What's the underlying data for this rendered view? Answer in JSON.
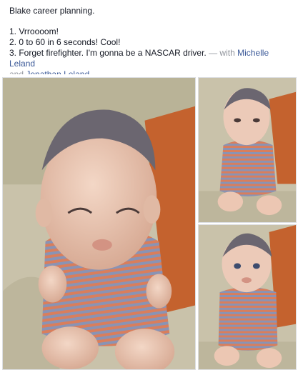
{
  "post": {
    "title": "Blake career planning.",
    "list": [
      "1. Vrroooom!",
      "2. 0 to 60 in 6 seconds! Cool!",
      "3. Forget firefighter. I'm gonna be a NASCAR driver."
    ],
    "with_prefix": " — with ",
    "tagged": [
      "Michelle Leland",
      "Jonathan Leland"
    ],
    "and_word": " and ",
    "end_punct": "."
  },
  "colors": {
    "link": "#3b5998",
    "muted": "#90949c",
    "text": "#141823",
    "couch_beige": "#c7bfa4",
    "pillow_orange": "#c4622e",
    "onesie_stripe_blue": "#8a93b4",
    "onesie_stripe_orange": "#d97e5c"
  },
  "photos": [
    {
      "name": "main photo",
      "icon": "baby-photo"
    },
    {
      "name": "top-right photo",
      "icon": "baby-photo"
    },
    {
      "name": "bottom-right photo",
      "icon": "baby-photo"
    }
  ]
}
